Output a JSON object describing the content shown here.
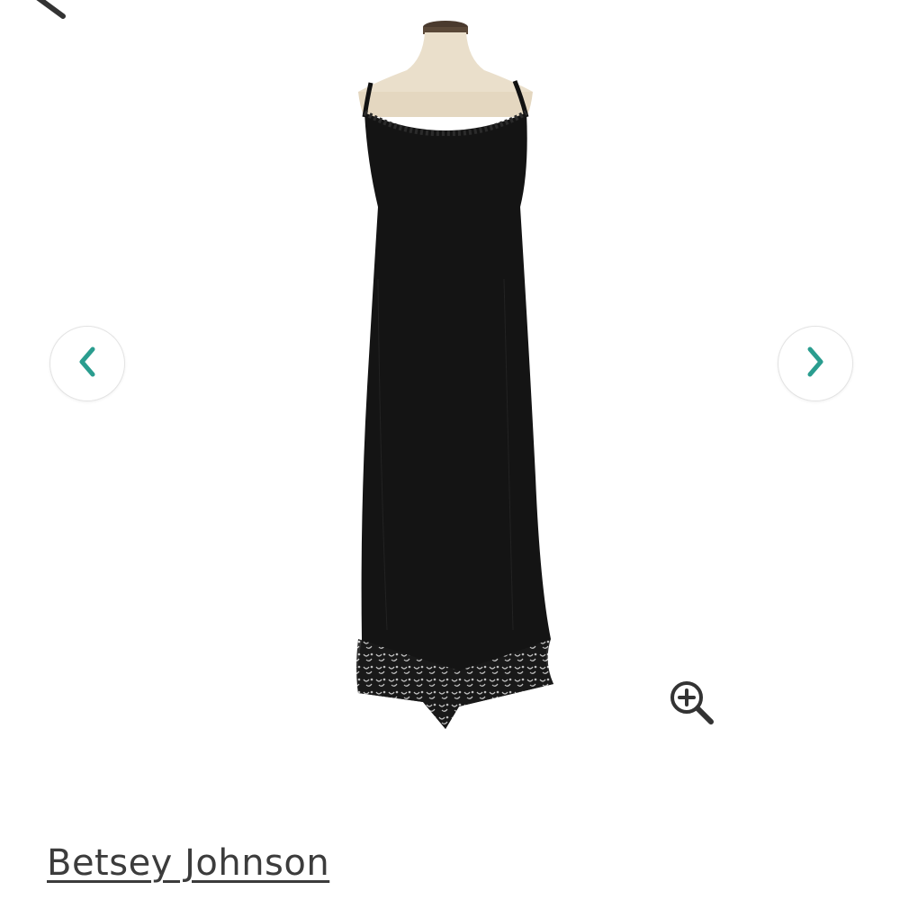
{
  "header": {
    "back_icon": "chevron-left-icon"
  },
  "gallery": {
    "image_subject": "black-slip-dress-on-mannequin",
    "prev_icon": "chevron-left-icon",
    "next_icon": "chevron-right-icon",
    "zoom_icon": "zoom-in-icon",
    "accent_color": "#2a9d8f"
  },
  "product": {
    "brand": "Betsey Johnson"
  }
}
